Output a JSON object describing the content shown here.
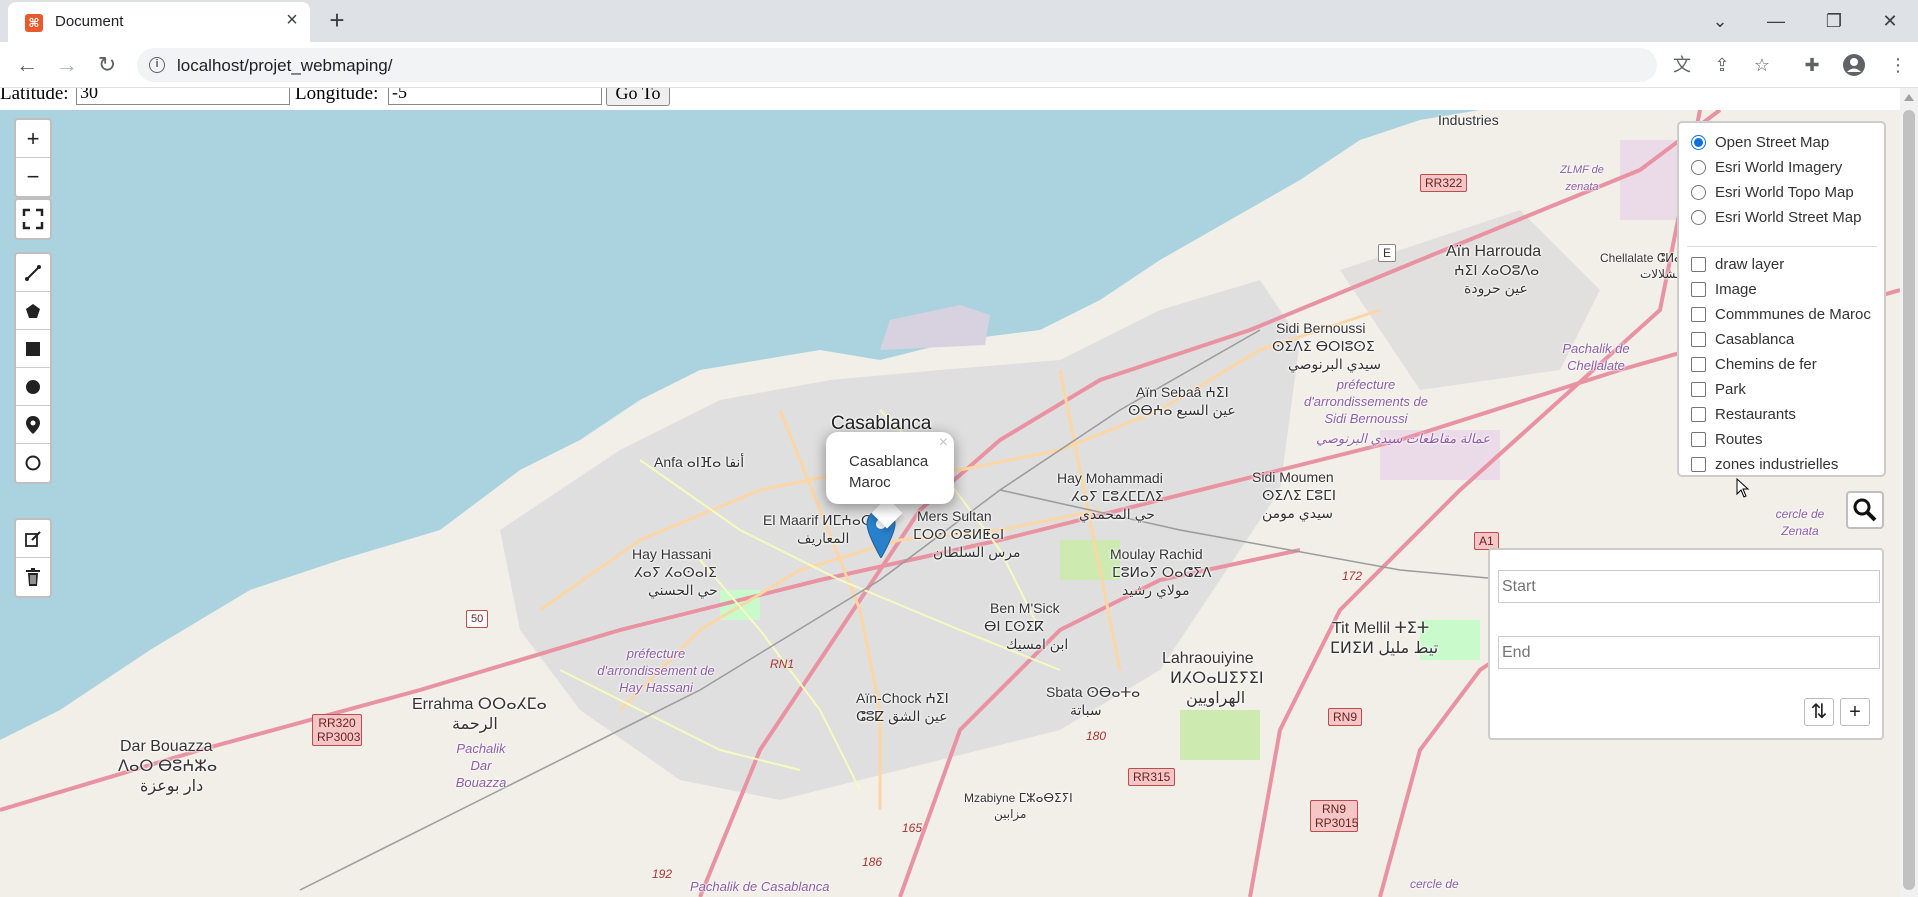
{
  "browser": {
    "tab_title": "Document",
    "url": "localhost/projet_webmaping/",
    "icons": [
      "favicon-icon",
      "close-icon",
      "plus-icon",
      "chevron-down-icon",
      "minimize-icon",
      "restore-icon",
      "close-window-icon",
      "back-icon",
      "forward-icon",
      "reload-icon",
      "info-icon",
      "translate-icon",
      "share-icon",
      "star-icon",
      "extensions-icon",
      "profile-icon",
      "menu-icon"
    ]
  },
  "form": {
    "latitude_label": "Latitude:",
    "latitude_value": "30",
    "longitude_label": "Longitude:",
    "longitude_value": "-5",
    "goto_label": "Go To"
  },
  "popup": {
    "line1": "Casablanca",
    "line2": "Maroc"
  },
  "layers": {
    "basemaps": [
      "Open Street Map",
      "Esri World Imagery",
      "Esri World Topo Map",
      "Esri World Street Map"
    ],
    "selected_basemap": "Open Street Map",
    "overlays": [
      "draw layer",
      "Image",
      "Commmunes de Maroc",
      "Casablanca",
      "Chemins de fer",
      "Park",
      "Restaurants",
      "Routes",
      "zones industrielles"
    ]
  },
  "routing": {
    "start_placeholder": "Start",
    "end_placeholder": "End"
  },
  "map_labels": {
    "industries": "Industries",
    "casablanca": "Casablanca",
    "anfa": "Anfa ⴰⵏⴼⴰ أنفا",
    "el_maarif": "El Maarif ⵍⵎⵄⴰⵔⵉⴼ",
    "el_maarif_ar": "المعاريف",
    "mers_sultan": "Mers Sultan",
    "mers_sultan_tif": "ⵎⵔⵙ ⵙⵓⵍⵟⴰⵏ",
    "mers_sultan_ar": "مرس السلطان",
    "hay_hassani": "Hay Hassani",
    "hay_hassani_tif": "ⵃⴰⵢ ⵃⴰⵙⴰⵏⵉ",
    "hay_hassani_ar": "حي الحسني",
    "hay_mohammadi": "Hay Mohammadi",
    "hay_mohammadi_tif": "ⵃⴰⵢ ⵎⵓⵃⵎⵎⴷⵉ",
    "hay_mohammadi_ar": "حي المحمدي",
    "ain_sebaa": "Aïn Sebaâ ⵄⵉⵏ",
    "ain_sebaa_tif": "ⵙⴱⵄⴰ عين السبع",
    "sidi_bernoussi": "Sidi Bernoussi",
    "sidi_bernoussi_tif": "ⵙⵉⴷⵉ ⴱⵔⵏⵓⵙⵉ",
    "sidi_bernoussi_ar": "سيدي البرنوصي",
    "sidi_moumen": "Sidi Moumen",
    "sidi_moumen_tif": "ⵙⵉⴷⵉ ⵎⵓⵎⵏ",
    "sidi_moumen_ar": "سيدي مومن",
    "ain_harrouda": "Aïn Harrouda",
    "ain_harrouda_tif": "ⵄⵉⵏ ⵃⴰⵔⵓⴷⴰ",
    "ain_harrouda_ar": "عين حرودة",
    "chellalate": "Chellalate ⵛⵍⴰⵍⴰⵜ",
    "chellalate_ar": "الشلالات",
    "moulay_rachid": "Moulay Rachid",
    "moulay_rachid_tif": "ⵎⵓⵍⴰⵢ ⵔⴰⵛⵉⴷ",
    "moulay_rachid_ar": "مولاي رشيد",
    "ben_msick": "Ben M'Sick",
    "ben_msick_tif": "ⴱⵏ ⵎⵙⵉⴽ",
    "ben_msick_ar": "ابن امسيك",
    "ain_chock": "Aïn-Chock ⵄⵉⵏ",
    "ain_chock_tif": "ⵛⵓⵇ عين الشق",
    "sbata": "Sbata ⵙⴱⴰⵜⴰ",
    "sbata_ar": "سباتة",
    "lahraouiyine": "Lahraouiyine",
    "lahraouiyine_tif": "ⵍⵃⵔⴰⵡⵉⵢⵉⵏ",
    "lahraouiyine_ar": "الهراويين",
    "tit_mellil": "Tit Mellil ⵜⵉⵜ",
    "tit_mellil_tif": "ⵎⵍⵉⵍ تيط مليل",
    "errahma": "Errahma ⵔⵔⴰⵃⵎⴰ",
    "errahma_ar": "الرحمة",
    "dar_bouazza": "Dar Bouazza",
    "dar_bouazza_tif": "ⴷⴰⵔ ⴱⵓⵄⵣⴰ",
    "dar_bouazza_ar": "دار بوعزة",
    "mzabiyne": "Mzabiyne ⵎⵣⴰⴱⵉⵢⵏ",
    "mzabiyne_ar": "مزابين",
    "pref_hay_hassani": "préfecture d'arrondissement de Hay Hassani",
    "pref_sidi_bernoussi": "préfecture d'arrondissements de Sidi Bernoussi",
    "pref_sidi_bernoussi_ar": "عمالة مقاطعات سيدي البرنوصي",
    "pachalik_chellalate": "Pachalik de Chellalate",
    "pachalik_dar_bouazza": "Pachalik Dar Bouazza",
    "pachalik_casablanca": "Pachalik de Casablanca",
    "zlmf": "ZLMF de zenata",
    "cercle_zenata": "cercle de Zenata",
    "cercle_de": "cercle de"
  },
  "road_shields": [
    "RR322",
    "E",
    "A1",
    "RN1",
    "RN9",
    "RR315",
    "RN9 RP3015",
    "RR320 RP3003",
    "180",
    "186",
    "165",
    "172",
    "192",
    "50"
  ]
}
